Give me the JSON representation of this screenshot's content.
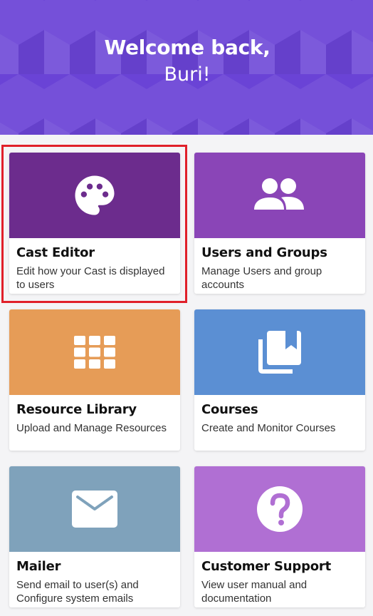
{
  "header": {
    "greeting": "Welcome back,",
    "username": "Buri!",
    "bg_color": "#6a43d6"
  },
  "cards": [
    {
      "title": "Cast Editor",
      "description": "Edit how your Cast is displayed to users",
      "color": "#6c2c8d",
      "icon": "palette-icon"
    },
    {
      "title": "Users and Groups",
      "description": "Manage Users and group accounts",
      "color": "#8a45b7",
      "icon": "users-icon"
    },
    {
      "title": "Resource Library",
      "description": "Upload and Manage Resources",
      "color": "#e69c57",
      "icon": "grid-icon"
    },
    {
      "title": "Courses",
      "description": "Create and Monitor Courses",
      "color": "#5b8fd3",
      "icon": "library-book-icon"
    },
    {
      "title": "Mailer",
      "description": "Send email to user(s) and Configure system emails",
      "color": "#7fa2bb",
      "icon": "mail-icon"
    },
    {
      "title": "Customer Support",
      "description": "View user manual and documentation",
      "color": "#b06fd3",
      "icon": "help-icon"
    }
  ],
  "highlight_color": "#e0202a"
}
